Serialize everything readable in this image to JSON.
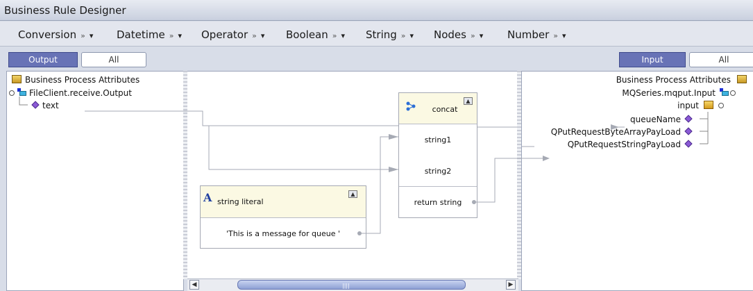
{
  "window": {
    "title": "Business Rule Designer"
  },
  "menubar": {
    "items": [
      {
        "label": "Conversion"
      },
      {
        "label": "Datetime"
      },
      {
        "label": "Operator"
      },
      {
        "label": "Boolean"
      },
      {
        "label": "String"
      },
      {
        "label": "Nodes"
      },
      {
        "label": "Number"
      }
    ],
    "chevron": "»",
    "dropdown": "▾"
  },
  "left_panel": {
    "toggle_selected": "Output",
    "toggle_other": "All",
    "tree": {
      "root": "Business Process Attributes",
      "child": "FileClient.receive.Output",
      "leaf": "text"
    }
  },
  "right_panel": {
    "toggle_selected": "Input",
    "toggle_other": "All",
    "tree": {
      "root": "Business Process Attributes",
      "child": "MQSeries.mqput.Input",
      "sub": "input",
      "fields": [
        "queueName",
        "QPutRequestByteArrayPayLoad",
        "QPutRequestStringPayLoad"
      ]
    }
  },
  "canvas": {
    "concat": {
      "title": "concat",
      "inputs": [
        "string1",
        "string2"
      ],
      "output": "return string"
    },
    "literal": {
      "title": "string literal",
      "icon_letter": "A",
      "value": "'This is a message for queue '"
    }
  },
  "colors": {
    "accent": "#6873b6",
    "wire": "#a6aab4",
    "diamond": "#8b5ad6",
    "header_fill": "#fbf9e3"
  }
}
